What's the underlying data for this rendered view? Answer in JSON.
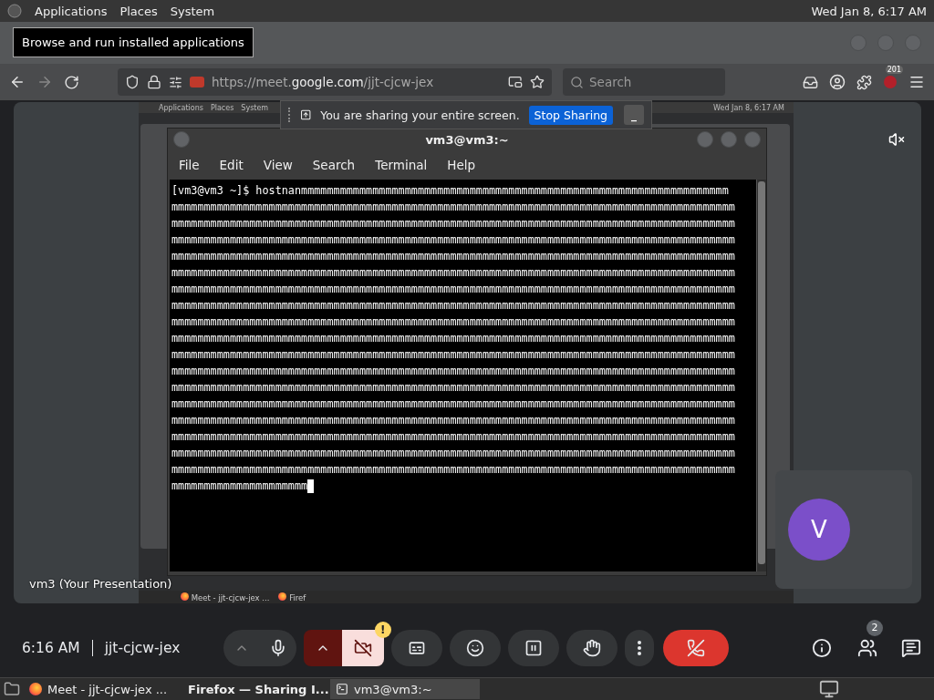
{
  "top_panel": {
    "menus": [
      "Applications",
      "Places",
      "System"
    ],
    "clock": "Wed Jan  8, 6:17 AM"
  },
  "tooltip": "Browse and run installed applications",
  "browser": {
    "url": {
      "prefix": "https://meet.",
      "domain": "google.com",
      "path": "/jjt-cjcw-jex"
    },
    "search_placeholder": "Search",
    "extension_badge": "201"
  },
  "share_bar": {
    "message": "You are sharing your entire screen.",
    "stop_button": "Stop Sharing",
    "hide_button": "_"
  },
  "shared_screen": {
    "panel_menus": [
      "Applications",
      "Places",
      "System"
    ],
    "clock": "Wed Jan  8, 6:17 AM",
    "taskbar": [
      "Meet - jjt-cjcw-jex ...",
      "Firef"
    ]
  },
  "terminal": {
    "title": "vm3@vm3:~",
    "menus": [
      "File",
      "Edit",
      "View",
      "Search",
      "Terminal",
      "Help"
    ],
    "lines": [
      "[vm3@vm3 ~]$ hostnanmmmmmmmmmmmmmmmmmmmmmmmmmmmmmmmmmmmmmmmmmmmmmmmmmmmmmmmmmmmmmmmmmm",
      "mmmmmmmmmmmmmmmmmmmmmmmmmmmmmmmmmmmmmmmmmmmmmmmmmmmmmmmmmmmmmmmmmmmmmmmmmmmmmmmmmmmmmmm",
      "mmmmmmmmmmmmmmmmmmmmmmmmmmmmmmmmmmmmmmmmmmmmmmmmmmmmmmmmmmmmmmmmmmmmmmmmmmmmmmmmmmmmmmm",
      "mmmmmmmmmmmmmmmmmmmmmmmmmmmmmmmmmmmmmmmmmmmmmmmmmmmmmmmmmmmmmmmmmmmmmmmmmmmmmmmmmmmmmmm",
      "mmmmmmmmmmmmmmmmmmmmmmmmmmmmmmmmmmmmmmmmmmmmmmmmmmmmmmmmmmmmmmmmmmmmmmmmmmmmmmmmmmmmmmm",
      "mmmmmmmmmmmmmmmmmmmmmmmmmmmmmmmmmmmmmmmmmmmmmmmmmmmmmmmmmmmmmmmmmmmmmmmmmmmmmmmmmmmmmmm",
      "mmmmmmmmmmmmmmmmmmmmmmmmmmmmmmmmmmmmmmmmmmmmmmmmmmmmmmmmmmmmmmmmmmmmmmmmmmmmmmmmmmmmmmm",
      "mmmmmmmmmmmmmmmmmmmmmmmmmmmmmmmmmmmmmmmmmmmmmmmmmmmmmmmmmmmmmmmmmmmmmmmmmmmmmmmmmmmmmmm",
      "mmmmmmmmmmmmmmmmmmmmmmmmmmmmmmmmmmmmmmmmmmmmmmmmmmmmmmmmmmmmmmmmmmmmmmmmmmmmmmmmmmmmmmm",
      "mmmmmmmmmmmmmmmmmmmmmmmmmmmmmmmmmmmmmmmmmmmmmmmmmmmmmmmmmmmmmmmmmmmmmmmmmmmmmmmmmmmmmmm",
      "mmmmmmmmmmmmmmmmmmmmmmmmmmmmmmmmmmmmmmmmmmmmmmmmmmmmmmmmmmmmmmmmmmmmmmmmmmmmmmmmmmmmmmm",
      "mmmmmmmmmmmmmmmmmmmmmmmmmmmmmmmmmmmmmmmmmmmmmmmmmmmmmmmmmmmmmmmmmmmmmmmmmmmmmmmmmmmmmmm",
      "mmmmmmmmmmmmmmmmmmmmmmmmmmmmmmmmmmmmmmmmmmmmmmmmmmmmmmmmmmmmmmmmmmmmmmmmmmmmmmmmmmmmmmm",
      "mmmmmmmmmmmmmmmmmmmmmmmmmmmmmmmmmmmmmmmmmmmmmmmmmmmmmmmmmmmmmmmmmmmmmmmmmmmmmmmmmmmmmmm",
      "mmmmmmmmmmmmmmmmmmmmmmmmmmmmmmmmmmmmmmmmmmmmmmmmmmmmmmmmmmmmmmmmmmmmmmmmmmmmmmmmmmmmmmm",
      "mmmmmmmmmmmmmmmmmmmmmmmmmmmmmmmmmmmmmmmmmmmmmmmmmmmmmmmmmmmmmmmmmmmmmmmmmmmmmmmmmmmmmmm",
      "mmmmmmmmmmmmmmmmmmmmmmmmmmmmmmmmmmmmmmmmmmmmmmmmmmmmmmmmmmmmmmmmmmmmmmmmmmmmmmmmmmmmmmm",
      "mmmmmmmmmmmmmmmmmmmmmmmmmmmmmmmmmmmmmmmmmmmmmmmmmmmmmmmmmmmmmmmmmmmmmmmmmmmmmmmmmmmmmmm",
      "mmmmmmmmmmmmmmmmmmmmm"
    ]
  },
  "presentation_label": "vm3 (Your Presentation)",
  "participant": {
    "initial": "V"
  },
  "meeting": {
    "time": "6:16 AM",
    "code": "jjt-cjcw-jex",
    "mic_on": true,
    "camera_on": false,
    "camera_warning": "!",
    "people_count": "2"
  },
  "taskbar": {
    "items": [
      {
        "label": "Meet - jjt-cjcw-jex ...",
        "kind": "browser",
        "selected": false
      },
      {
        "label": "Firefox — Sharing I...",
        "kind": "browser",
        "selected": true
      },
      {
        "label": "vm3@vm3:~",
        "kind": "terminal",
        "selected": false
      }
    ]
  }
}
